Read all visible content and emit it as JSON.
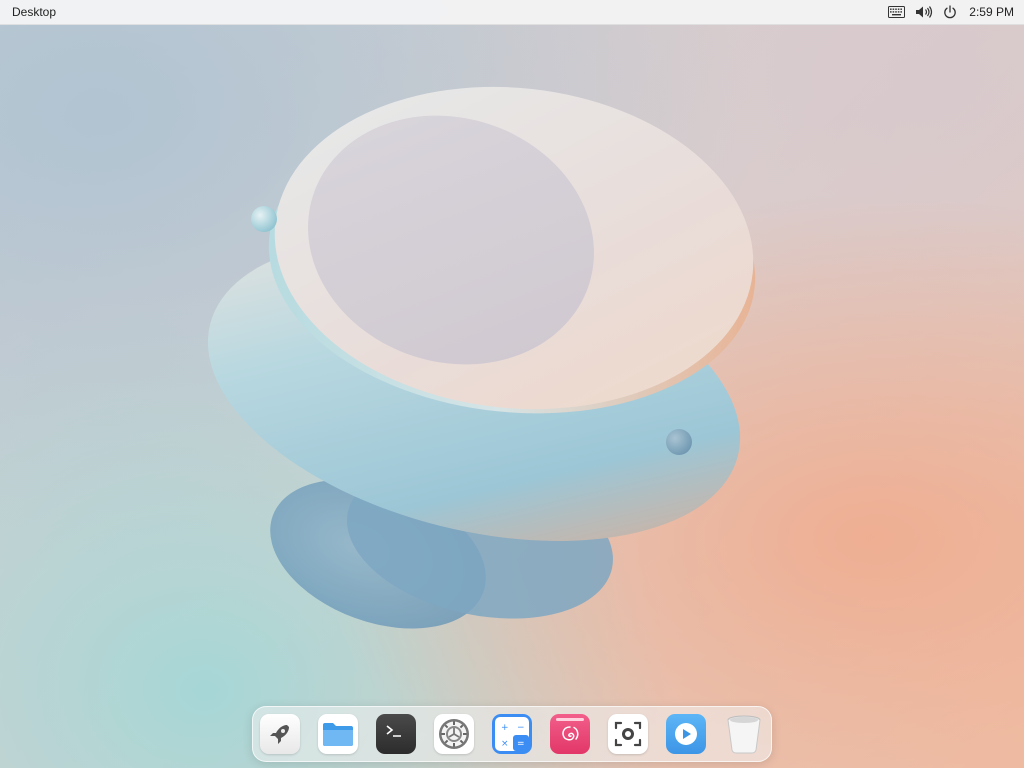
{
  "top_panel": {
    "title": "Desktop",
    "tray": {
      "keyboard_icon": "keyboard-icon",
      "volume_icon": "volume-icon",
      "power_icon": "power-icon",
      "clock": "2:59 PM"
    }
  },
  "dock": {
    "items": [
      {
        "name": "launcher",
        "icon": "rocket-icon",
        "color": "#f4f4f4"
      },
      {
        "name": "file-manager",
        "icon": "folder-icon",
        "color": "#ffffff"
      },
      {
        "name": "terminal",
        "icon": "terminal-icon",
        "color": "#3a3a3a"
      },
      {
        "name": "settings",
        "icon": "gear-icon",
        "color": "#ffffff"
      },
      {
        "name": "calculator",
        "icon": "calculator-icon",
        "color": "#3b8df3"
      },
      {
        "name": "debian-app",
        "icon": "debian-swirl-icon",
        "color": "#ef4a7c"
      },
      {
        "name": "screenshot",
        "icon": "screenshot-icon",
        "color": "#ffffff"
      },
      {
        "name": "media-player",
        "icon": "play-icon",
        "color": "#4aa8f0"
      },
      {
        "name": "trash",
        "icon": "trash-icon",
        "color": "#f0f0f0"
      }
    ]
  }
}
